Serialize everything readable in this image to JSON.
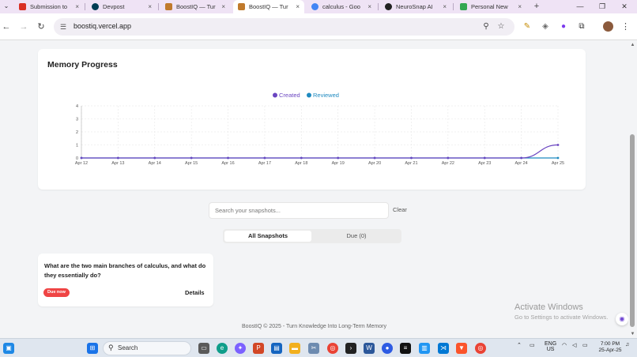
{
  "browser": {
    "tabs": [
      {
        "label": "Submission to",
        "favicon_color": "#d93025",
        "favicon": "gmail-icon"
      },
      {
        "label": "Devpost",
        "favicon_color": "#003e54",
        "favicon": "devpost-icon"
      },
      {
        "label": "BoostIQ — Tur",
        "favicon_color": "#c07a2c",
        "favicon": "boostiq-icon"
      },
      {
        "label": "BoostIQ — Tur",
        "favicon_color": "#c07a2c",
        "favicon": "boostiq-icon",
        "active": true
      },
      {
        "label": "calculus - Goo",
        "favicon_color": "#4285f4",
        "favicon": "google-icon"
      },
      {
        "label": "NeuroSnap AI",
        "favicon_color": "#222222",
        "favicon": "neurosnap-icon"
      },
      {
        "label": "Personal New",
        "favicon_color": "#34a853",
        "favicon": "personal-icon"
      }
    ],
    "close_glyph": "×",
    "new_tab_glyph": "+",
    "url": "boostiq.vercel.app",
    "window_controls": [
      "—",
      "❐",
      "✕"
    ]
  },
  "chart_card": {
    "title": "Memory Progress"
  },
  "chart_data": {
    "type": "line",
    "title": "Memory Progress",
    "x": [
      "Apr 12",
      "Apr 13",
      "Apr 14",
      "Apr 15",
      "Apr 16",
      "Apr 17",
      "Apr 18",
      "Apr 19",
      "Apr 20",
      "Apr 21",
      "Apr 22",
      "Apr 23",
      "Apr 24",
      "Apr 25"
    ],
    "ylim": [
      0,
      4
    ],
    "yticks": [
      0,
      1,
      2,
      3,
      4
    ],
    "grid": true,
    "legend_position": "top-center",
    "series": [
      {
        "name": "Created",
        "color": "#6b46c1",
        "values": [
          0,
          0,
          0,
          0,
          0,
          0,
          0,
          0,
          0,
          0,
          0,
          0,
          0,
          1
        ]
      },
      {
        "name": "Reviewed",
        "color": "#1f8ac0",
        "values": [
          0,
          0,
          0,
          0,
          0,
          0,
          0,
          0,
          0,
          0,
          0,
          0,
          0,
          0
        ]
      }
    ]
  },
  "search": {
    "placeholder": "Search your snapshots...",
    "clear_label": "Clear"
  },
  "filter_tabs": [
    {
      "label": "All Snapshots",
      "active": true
    },
    {
      "label": "Due (0)",
      "active": false
    }
  ],
  "snapshots": [
    {
      "question": "What are the two main branches of calculus, and what do they essentially do?",
      "badge": "Due now",
      "details_label": "Details"
    }
  ],
  "watermark": {
    "line1": "Activate Windows",
    "line2": "Go to Settings to activate Windows."
  },
  "footer": "BoostIQ © 2025 - Turn Knowledge Into Long-Term Memory",
  "taskbar": {
    "search_label": "Search",
    "lang_top": "ENG",
    "lang_bottom": "US",
    "time": "7:00 PM",
    "date": "25-Apr-25"
  },
  "colors": {
    "accent": "#6b46c1",
    "reviewed": "#1f8ac0",
    "danger": "#ef4444"
  }
}
